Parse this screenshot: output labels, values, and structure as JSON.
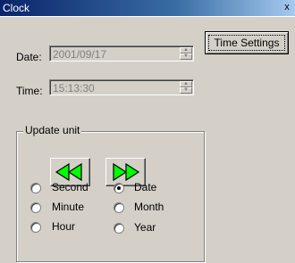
{
  "window": {
    "title": "Clock",
    "close_glyph": "x"
  },
  "date": {
    "label": "Date:",
    "value": "2001/09/17"
  },
  "time": {
    "label": "Time:",
    "value": "15:13:30"
  },
  "time_settings_button": "Time Settings",
  "update_unit": {
    "legend": "Update unit",
    "rewind_icon": "rewind-icon",
    "forward_icon": "fast-forward-icon",
    "arrow_color": "#00ff00",
    "options": [
      {
        "label": "Second",
        "checked": false
      },
      {
        "label": "Minute",
        "checked": false
      },
      {
        "label": "Hour",
        "checked": false
      },
      {
        "label": "Date",
        "checked": true
      },
      {
        "label": "Month",
        "checked": false
      },
      {
        "label": "Year",
        "checked": false
      }
    ]
  }
}
